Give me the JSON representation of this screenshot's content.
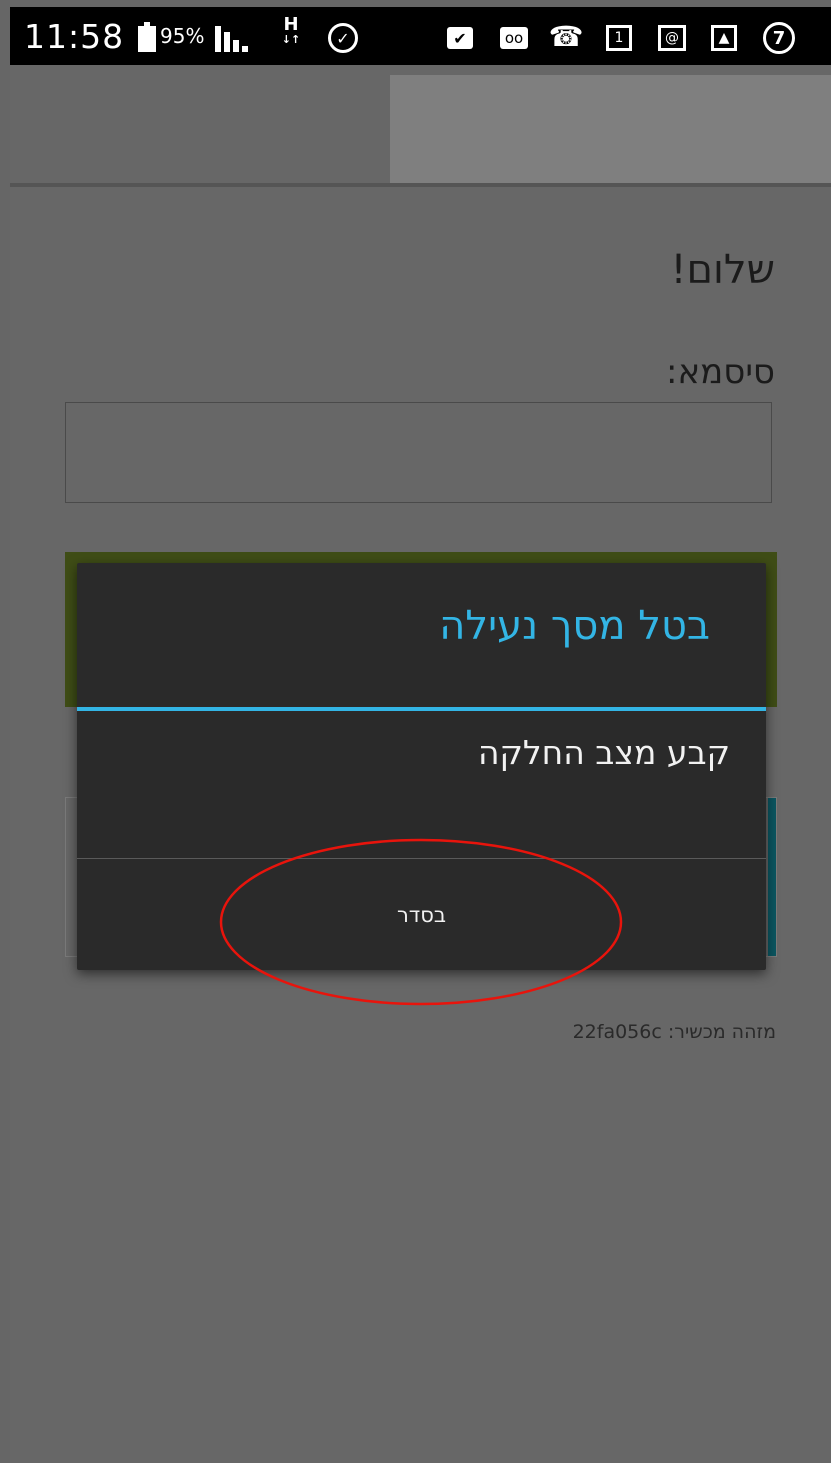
{
  "status_bar": {
    "time": "11:58",
    "battery": "95%",
    "network": "H",
    "notification_count": "7",
    "icons": [
      "battery-icon",
      "signal-icon",
      "network-h-icon",
      "alarm-icon",
      "briefcase-icon",
      "voicemail-icon",
      "missed-call-icon",
      "calendar-icon",
      "email-icon",
      "image-icon",
      "notification-count-icon"
    ]
  },
  "page": {
    "greeting": "שלום!",
    "password_label": "סיסמא:",
    "password_value": "",
    "device_id": "מזהה מכשיר: 22fa056c"
  },
  "dialog": {
    "title": "בטל מסך נעילה",
    "message": "קבע מצב החלקה",
    "ok_label": "בסדר"
  },
  "colors": {
    "accent": "#33b5e5",
    "highlight": "#e8140c",
    "dialog_bg": "#2a2a2a",
    "overlay_bg": "#676767"
  }
}
